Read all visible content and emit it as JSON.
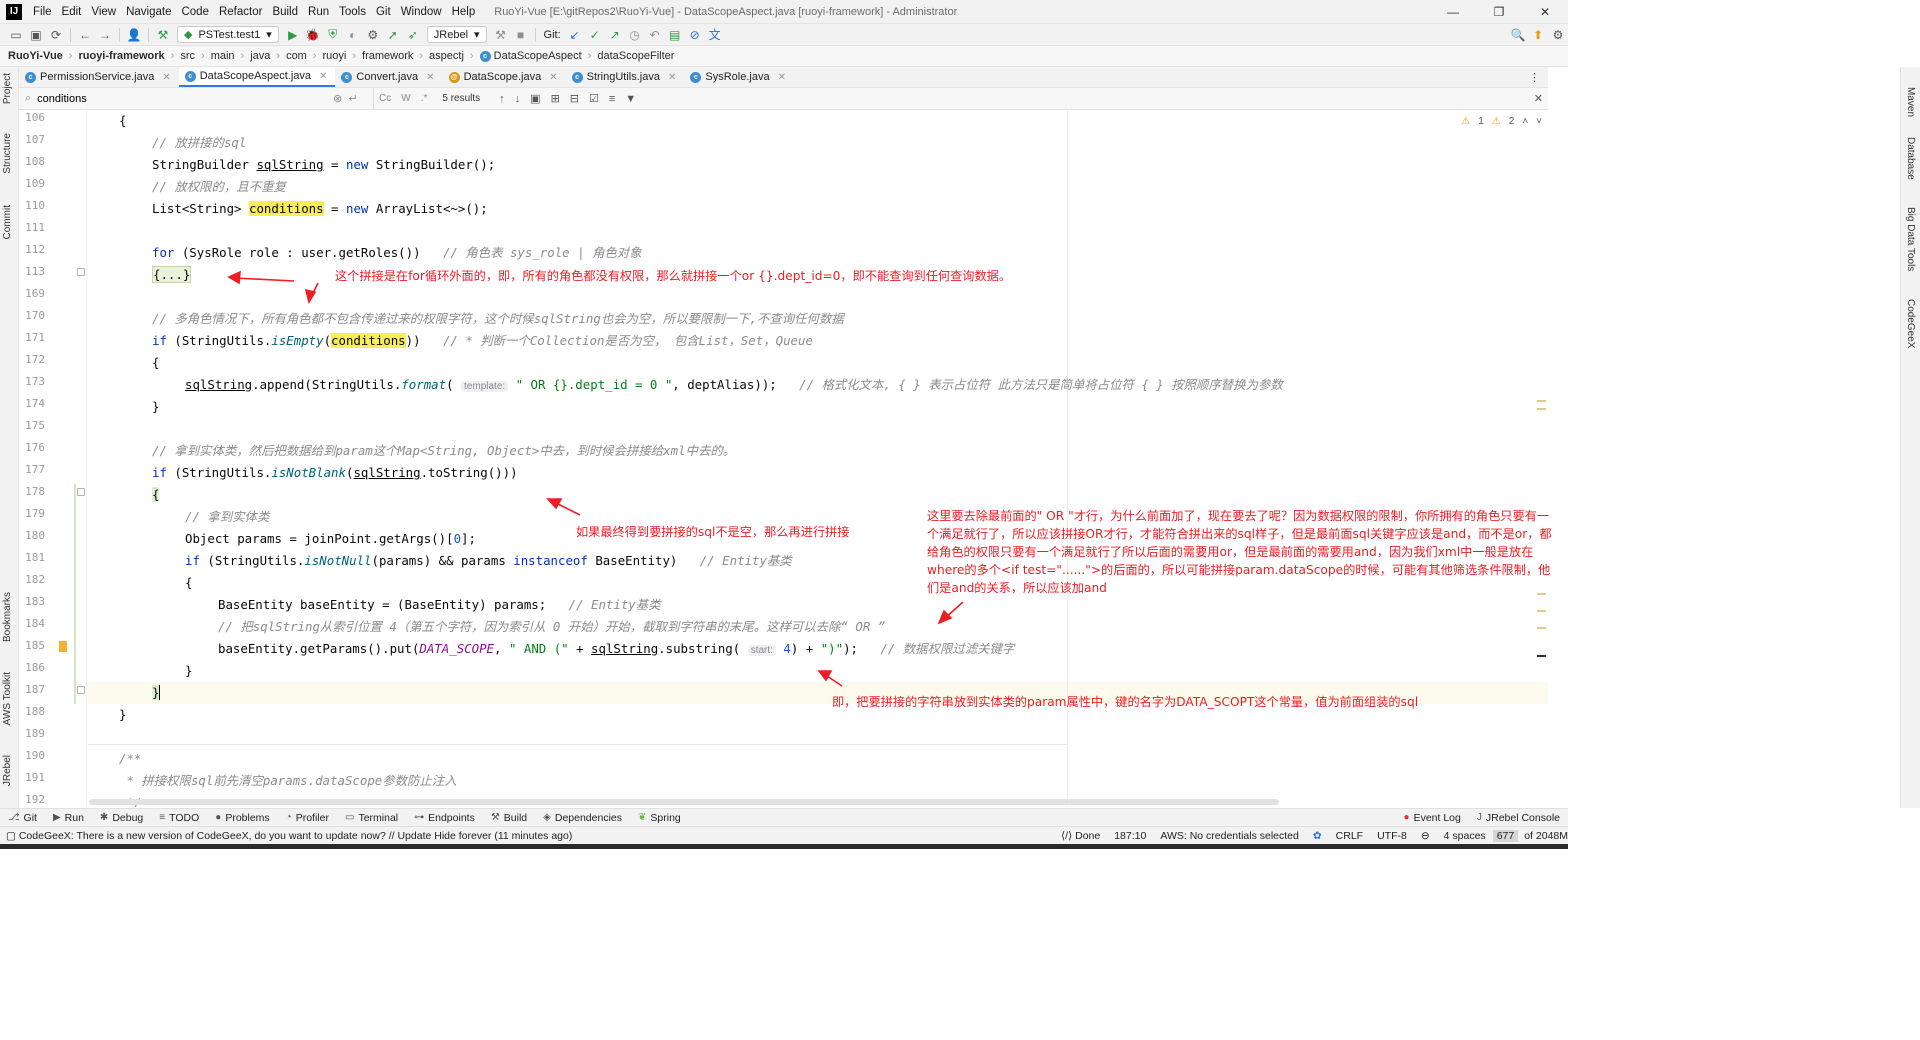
{
  "window": {
    "logo": "IJ",
    "title": "RuoYi-Vue [E:\\gitRepos2\\RuoYi-Vue] - DataScopeAspect.java [ruoyi-framework] - Administrator",
    "menu": [
      "File",
      "Edit",
      "View",
      "Navigate",
      "Code",
      "Refactor",
      "Build",
      "Run",
      "Tools",
      "Git",
      "Window",
      "Help"
    ],
    "controls": [
      "—",
      "❐",
      "✕"
    ]
  },
  "toolbar": {
    "run_config": "PSTest.test1",
    "jrebel": "JRebel",
    "git_label": "Git:"
  },
  "breadcrumb": [
    "RuoYi-Vue",
    "ruoyi-framework",
    "src",
    "main",
    "java",
    "com",
    "ruoyi",
    "framework",
    "aspectj",
    "DataScopeAspect",
    "dataScopeFilter"
  ],
  "left_tools": [
    "Project",
    "Structure",
    "Commit",
    "Bookmarks",
    "AWS Toolkit",
    "JRebel"
  ],
  "right_tools": [
    "Maven",
    "Database",
    "Big Data Tools",
    "CodeGeeX"
  ],
  "tabs": [
    {
      "label": "PermissionService.java",
      "active": false
    },
    {
      "label": "DataScopeAspect.java",
      "active": true
    },
    {
      "label": "Convert.java",
      "active": false
    },
    {
      "label": "DataScope.java",
      "active": false
    },
    {
      "label": "StringUtils.java",
      "active": false
    },
    {
      "label": "SysRole.java",
      "active": false
    }
  ],
  "find": {
    "query": "conditions",
    "options": [
      "Cc",
      "W",
      ".*"
    ],
    "results": "5 results"
  },
  "inspection": {
    "warnings_1": "1",
    "warnings_2": "2"
  },
  "line_numbers": [
    "106",
    "107",
    "108",
    "109",
    "110",
    "111",
    "112",
    "113",
    "169",
    "170",
    "171",
    "172",
    "173",
    "174",
    "175",
    "176",
    "177",
    "178",
    "179",
    "180",
    "181",
    "182",
    "183",
    "184",
    "185",
    "186",
    "187",
    "188",
    "189",
    "190",
    "191",
    "192"
  ],
  "code": {
    "l106": "{",
    "l107": "// 放拼接的sql",
    "l108_a": "StringBuilder ",
    "l108_b": "sqlString",
    "l108_c": " = ",
    "l108_d": "new",
    "l108_e": " StringBuilder();",
    "l109": "// 放权限的，且不重复",
    "l110_a": "List<String> ",
    "l110_b": "conditions",
    "l110_c": " = ",
    "l110_d": "new",
    "l110_e": " ArrayList<~>();",
    "l112_a": "for",
    "l112_b": " (SysRole role : user.getRoles())   ",
    "l112_c": "// 角色表 sys_role | 角色对象",
    "l113": "{...}",
    "l170": "// 多角色情况下，所有角色都不包含传递过来的权限字符，这个时候sqlString也会为空，所以要限制一下,不查询任何数据",
    "l171_a": "if",
    "l171_b": " (StringUtils.",
    "l171_c": "isEmpty",
    "l171_d": "(",
    "l171_e": "conditions",
    "l171_f": "))   ",
    "l171_g": "// * 判断一个Collection是否为空， 包含List，Set，Queue",
    "l172": "{",
    "l173_a": "sqlString",
    "l173_b": ".append(StringUtils.",
    "l173_c": "format",
    "l173_d": "( ",
    "l173_hint": "template:",
    "l173_e": " \" OR {}.dept_id = 0 \"",
    "l173_f": ", deptAlias));   ",
    "l173_g": "// 格式化文本, { } 表示占位符 此方法只是简单将占位符 { } 按照顺序替换为参数",
    "l174": "}",
    "l176": "// 拿到实体类，然后把数据给到param这个Map<String, Object>中去，到时候会拼接给xml中去的。",
    "l177_a": "if",
    "l177_b": " (StringUtils.",
    "l177_c": "isNotBlank",
    "l177_d": "(",
    "l177_e": "sqlString",
    "l177_f": ".toString()))",
    "l178": "{",
    "l179": "// 拿到实体类",
    "l180_a": "Object params = joinPoint.getArgs()[",
    "l180_b": "0",
    "l180_c": "];",
    "l181_a": "if",
    "l181_b": " (StringUtils.",
    "l181_c": "isNotNull",
    "l181_d": "(params) && params ",
    "l181_e": "instanceof",
    "l181_f": " BaseEntity)   ",
    "l181_g": "// Entity基类",
    "l182": "{",
    "l183_a": "BaseEntity baseEntity = (BaseEntity) params;   ",
    "l183_b": "// Entity基类",
    "l184": "// 把sqlString从索引位置 4（第五个字符，因为索引从 0 开始）开始，截取到字符串的末尾。这样可以去除“ OR ”",
    "l185_a": "baseEntity.getParams().put(",
    "l185_b": "DATA_SCOPE",
    "l185_c": ", ",
    "l185_d": "\" AND (\"",
    "l185_e": " + ",
    "l185_f": "sqlString",
    "l185_g": ".substring( ",
    "l185_hint": "start:",
    "l185_h": " 4",
    "l185_i": ") + ",
    "l185_j": "\")\"",
    "l185_k": ");   ",
    "l185_l": "// 数据权限过滤关键字",
    "l186": "}",
    "l187": "}",
    "l188": "}",
    "l190": "/**",
    "l191": " * 拼接权限sql前先清空params.dataScope参数防止注入",
    "l192": " */"
  },
  "annotations": {
    "a1": "这个拼接是在for循环外面的，即，所有的角色都没有权限，那么就拼接一个or {}.dept_id=0，即不能查询到任何查询数据。",
    "a2": "如果最终得到要拼接的sql不是空，那么再进行拼接",
    "a3": "这里要去除最前面的\" OR \"才行，为什么前面加了，现在要去了呢？因为数据权限的限制，你所拥有的角色只要有一个满足就行了，所以应该拼接OR才行，才能符合拼出来的sql样子，但是最前面sql关键字应该是and，而不是or，都给角色的权限只要有一个满足就行了所以后面的需要用or，但是最前面的需要用and，因为我们xml中一般是放在where的多个<if test=\"......\">的后面的，所以可能拼接param.dataScope的时候，可能有其他筛选条件限制，他们是and的关系，所以应该加and",
    "a4": "即，把要拼接的字符串放到实体类的param属性中，键的名字为DATA_SCOPT这个常量，值为前面组装的sql"
  },
  "bottom_tools": [
    "Git",
    "Run",
    "Debug",
    "TODO",
    "Problems",
    "Profiler",
    "Terminal",
    "Endpoints",
    "Build",
    "Dependencies",
    "Spring"
  ],
  "bottom_right_tools": [
    "Event Log",
    "JRebel Console"
  ],
  "status": {
    "message": "CodeGeeX: There is a new version of CodeGeeX, do you want to update now? // Update   Hide forever (11 minutes ago)",
    "done": "Done",
    "position": "187:10",
    "aws": "AWS: No credentials selected",
    "line_sep": "CRLF",
    "encoding": "UTF-8",
    "indent": "4 spaces",
    "memory_used": "677",
    "memory_total": "of 2048M"
  },
  "colors": {
    "accent": "#3574f0",
    "annotation": "#ee1d24",
    "highlight": "#f7ef55",
    "keyword": "#0033b3",
    "comment": "#8c8c8c",
    "string": "#067d17"
  }
}
